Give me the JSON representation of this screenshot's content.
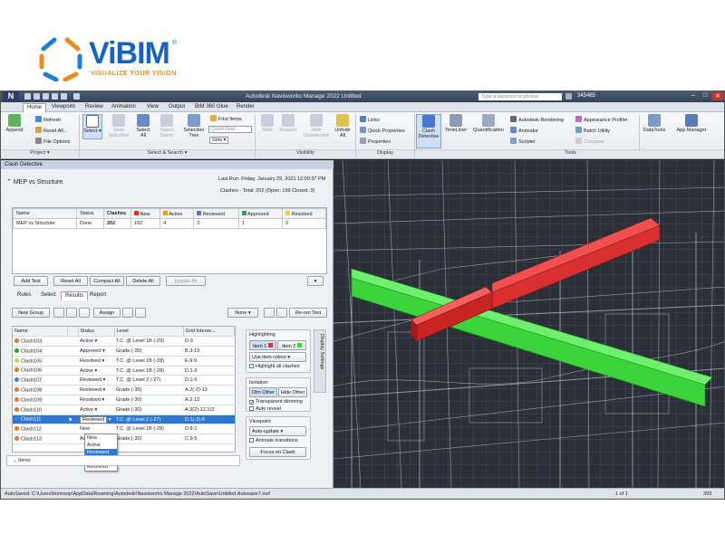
{
  "logo": {
    "brand_main": "ViBIM",
    "reg": "®",
    "tagline": "VISUALIZE YOUR VISION"
  },
  "app": {
    "title": "Autodesk Navisworks Manage 2022   Untitled",
    "search_placeholder": "Type a keyword or phrase",
    "user": "345465",
    "tabs": [
      "Home",
      "Viewpoint",
      "Review",
      "Animation",
      "View",
      "Output",
      "BIM 360 Glue",
      "Render"
    ],
    "active_tab": "Home"
  },
  "ribbon": {
    "append": "Append",
    "refresh": "Refresh",
    "reset_all": "Reset All...",
    "file_options": "File Options",
    "select": "Select",
    "save_selection": "Save Selection",
    "select_all": "Select All",
    "select_same": "Select Same",
    "selection_tree": "Selection Tree",
    "find_items": "Find Items",
    "quick_find": "Quick Find",
    "sets": "Sets",
    "hide": "Hide",
    "require": "Require",
    "hide_unselected": "Hide Unselected",
    "unhide_all": "Unhide All",
    "links": "Links",
    "quick_properties": "Quick Properties",
    "properties": "Properties",
    "clash_detective": "Clash Detective",
    "timeliner": "TimeLiner",
    "quantification": "Quantification",
    "autodesk_rendering": "Autodesk Rendering",
    "animator": "Animator",
    "scripter": "Scripter",
    "appearance_profiler": "Appearance Profiler",
    "batch_utility": "Batch Utility",
    "compare": "Compare",
    "datatools": "DataTools",
    "app_manager": "App Manager",
    "groups": {
      "project": "Project ▾",
      "select_search": "Select & Search ▾",
      "visibility": "Visibility",
      "display": "Display",
      "tools": "Tools"
    }
  },
  "clash": {
    "panel_title": "Clash Detective",
    "test_name": "MEP vs Structure",
    "last_run": "Last Run:  Friday, January 29, 2021 12:00:37 PM",
    "clashes_summary": "Clashes - Total: 202  (Open: 199  Closed: 3)",
    "summary_headers": [
      "Name",
      "Status",
      "Clashes",
      "New",
      "Active",
      "Reviewed",
      "Approved",
      "Resolved"
    ],
    "summary_row": [
      "MEP vs Structure",
      "Done",
      "202",
      "192",
      "4",
      "3",
      "1",
      "2"
    ],
    "buttons": {
      "add_test": "Add Test",
      "reset_all": "Reset All",
      "compact_all": "Compact All",
      "delete_all": "Delete All",
      "update_all": "Update All"
    },
    "subtabs": [
      "Rules",
      "Select",
      "Results",
      "Report"
    ],
    "active_subtab": "Results",
    "toolbar": {
      "new_group": "New Group",
      "assign": "Assign",
      "none": "None ▾",
      "rerun": "Re-run Test"
    },
    "result_headers": [
      "Name",
      "Status",
      "Level",
      "Grid Interse..."
    ],
    "results": [
      {
        "name": "Clash103",
        "status": "Active",
        "level": "T.C. @ Level 1B (-29)",
        "grid": "D-3",
        "color": "#e8742a"
      },
      {
        "name": "Clash104",
        "status": "Approved",
        "level": "Grade (-30)",
        "grid": "B.3-13",
        "color": "#2d9a3b"
      },
      {
        "name": "Clash105",
        "status": "Resolved",
        "level": "T.C. @ Level 1B (-28)",
        "grid": "E.9-9",
        "color": "#d8d040"
      },
      {
        "name": "Clash106",
        "status": "Active",
        "level": "T.C. @ Level 1B (-28)",
        "grid": "D.1-9",
        "color": "#e8742a"
      },
      {
        "name": "Clash107",
        "status": "Reviewed",
        "level": "T.C. @ Level 2 (-27)",
        "grid": "D.1-5",
        "color": "#3a7fd8"
      },
      {
        "name": "Clash108",
        "status": "Reviewed",
        "level": "Grade (-30)",
        "grid": "A.2(-2)-13",
        "color": "#e8742a"
      },
      {
        "name": "Clash109",
        "status": "Resolved",
        "level": "Grade (-30)",
        "grid": "A.2-13",
        "color": "#e8742a"
      },
      {
        "name": "Clash110",
        "status": "Active",
        "level": "Grade (-30)",
        "grid": "A.3(2)-12.1(2",
        "color": "#e8742a"
      },
      {
        "name": "Clash111",
        "status": "Reviewed",
        "level": "T.C. @ Level 2 (-27)",
        "grid": "D.1(-2)-6",
        "color": "#3a7fd8"
      },
      {
        "name": "Clash112",
        "status": "New",
        "level": "T.C. @ Level 1B (-28)",
        "grid": "D.8-1",
        "color": "#e8742a"
      },
      {
        "name": "Clash113",
        "status": "Active",
        "level": "Grade (-30)",
        "grid": "C.9-5",
        "color": "#e8742a"
      }
    ],
    "selected_index": 8,
    "status_dropdown": [
      "New",
      "Active",
      "Reviewed",
      "Approved",
      "Resolved"
    ],
    "dropdown_selected": "Reviewed",
    "items_label": "Items",
    "display_settings_tab": "Display Settings",
    "highlighting": {
      "title": "Highlighting",
      "item1": "Item 1",
      "item2": "Item 2",
      "use_colors": "Use item colors",
      "highlight_all": "Highlight all clashes"
    },
    "isolation": {
      "title": "Isolation",
      "dim_other": "Dim Other",
      "hide_other": "Hide Other",
      "transparent_dimming": "Transparent dimming",
      "auto_reveal": "Auto reveal"
    },
    "viewpoint": {
      "title": "Viewpoint",
      "auto_update": "Auto-update",
      "animate": "Animate transitions",
      "focus": "Focus on Clash"
    }
  },
  "status_bar": {
    "path": "AutoSaved: C:\\Users\\bonnsop\\AppData\\Roaming\\Autodesk\\Navisworks Manage 2022\\AutoSave\\Untitled.Autosave7.nwf",
    "page": "1 of 1",
    "memory": "393"
  },
  "colors": {
    "new": "#d9342b",
    "active": "#f39c12",
    "reviewed": "#3a7fd8",
    "approved": "#2da44e",
    "resolved": "#f5d418",
    "selection_blue": "#2d78d2",
    "clash_green": "#36d836",
    "clash_red": "#e03030"
  }
}
